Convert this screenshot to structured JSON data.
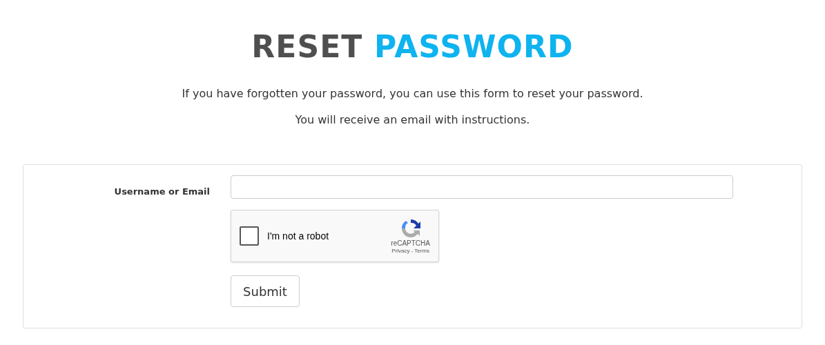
{
  "title": {
    "first": "RESET",
    "second": "PASSWORD"
  },
  "intro": [
    "If you have forgotten your password, you can use this form to reset your password.",
    "You will receive an email with instructions."
  ],
  "form": {
    "label": "Username or Email",
    "captcha": {
      "label": "I'm not a robot",
      "checked": false,
      "brand": "reCAPTCHA",
      "links": [
        "Privacy",
        "Terms"
      ],
      "separator": "-"
    },
    "submit": "Submit"
  }
}
